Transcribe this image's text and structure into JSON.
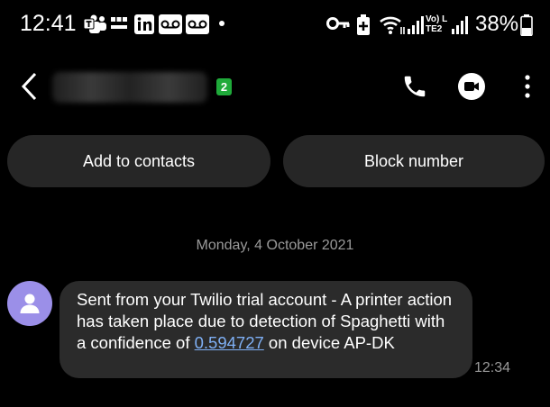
{
  "status_bar": {
    "time": "12:41",
    "battery_percent": "38%",
    "network_label": "Vo) LTE2",
    "left_icons": [
      "teams-icon",
      "bbc-news-icon",
      "linkedin-icon",
      "voicemail-icon",
      "voicemail-icon",
      "dot-icon"
    ],
    "right_icons": [
      "key-icon",
      "battery-saver-icon",
      "wifi-icon",
      "signal-icon",
      "signal-icon",
      "battery-icon"
    ]
  },
  "header": {
    "back_icon": "chevron-left-icon",
    "contact_name": "",
    "sim_badge": "2",
    "actions": [
      "phone-icon",
      "video-call-icon",
      "more-vertical-icon"
    ]
  },
  "contact_actions": {
    "add_label": "Add to contacts",
    "block_label": "Block number"
  },
  "conversation": {
    "date": "Monday, 4 October 2021",
    "message": {
      "text_before": "Sent from your Twilio trial account - A printer action has taken place due to detection of Spaghetti with a confidence of ",
      "link": "0.594727",
      "text_after": " on device AP-DK",
      "time": "12:34"
    }
  },
  "colors": {
    "background": "#000000",
    "pill": "#262626",
    "bubble": "#2b2b2b",
    "avatar": "#9b8fe8",
    "link": "#7fb0f5",
    "badge": "#1faa3a",
    "muted_text": "#9a9a9a"
  }
}
